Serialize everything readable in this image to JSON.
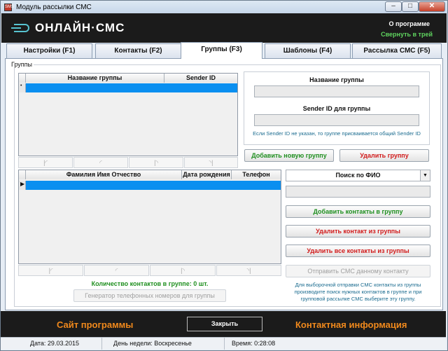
{
  "window": {
    "title": "Модуль рассылки СМС",
    "app_icon": "SMS"
  },
  "header": {
    "logo": "ОНЛАЙН·СМС",
    "about": "О программе",
    "tray": "Свернуть в трей"
  },
  "tabs": [
    {
      "label": "Настройки (F1)"
    },
    {
      "label": "Контакты (F2)"
    },
    {
      "label": "Группы (F3)",
      "active": true
    },
    {
      "label": "Шаблоны (F4)"
    },
    {
      "label": "Рассылка СМС (F5)"
    }
  ],
  "groups": {
    "legend": "Группы",
    "table_columns": [
      "Название группы",
      "Sender ID"
    ],
    "name_label": "Название группы",
    "name_value": "",
    "sender_label": "Sender ID для группы",
    "sender_value": "",
    "sender_note": "Если Sender ID не указан, то группе присваивается общий Sender ID",
    "add_button": "Добавить новую группу",
    "delete_button": "Удалить группу"
  },
  "nav": {
    "first": "|◜",
    "prev": "◜",
    "next": "|◝",
    "last": "◝|"
  },
  "contacts": {
    "table_columns": [
      "Фамилия Имя Отчество",
      "Дата рождения",
      "Телефон"
    ],
    "search_mode": "Поиск по ФИО",
    "search_value": "",
    "add_button": "Добавить контакты в группу",
    "delete_button": "Удалить контакт из группы",
    "delete_all_button": "Удалить все контакты из группы",
    "send_button": "Отправить СМС данному контакту",
    "count_text": "Количество контактов в группе: 0 шт.",
    "generator_button": "Генератор телефонных номеров для группы",
    "note": "Для выборочной отправки СМС контакты из группы производите поиск нужных контактов в группе и при групповой рассылке СМС выберите эту группу."
  },
  "footer": {
    "site": "Сайт программы",
    "close": "Закрыть",
    "contact": "Контактная информация"
  },
  "status": {
    "date": "Дата: 29.03.2015",
    "weekday": "День недели: Воскресенье",
    "time": "Время: 0:28:08"
  },
  "colors": {
    "header_bg": "#1b1b1b",
    "accent_orange": "#f0891c",
    "green": "#1f8f1f",
    "red": "#d11a1a",
    "selection": "#0a8ff0"
  }
}
